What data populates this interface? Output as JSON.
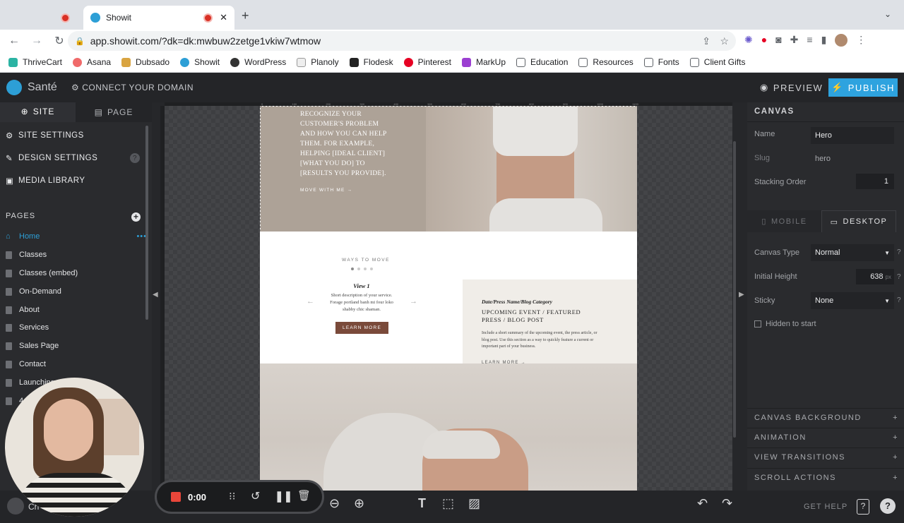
{
  "browser": {
    "tabs": [
      {
        "title": ""
      },
      {
        "title": "Showit"
      }
    ],
    "url": "app.showit.com/?dk=dk:mwbuw2zetge1vkiw7wtmow",
    "bookmarks": [
      "ThriveCart",
      "Asana",
      "Dubsado",
      "Showit",
      "WordPress",
      "Planoly",
      "Flodesk",
      "Pinterest",
      "MarkUp",
      "Education",
      "Resources",
      "Fonts",
      "Client Gifts"
    ]
  },
  "app": {
    "site_name": "Santé",
    "connect_domain": "CONNECT YOUR DOMAIN",
    "preview": "PREVIEW",
    "publish": "PUBLISH"
  },
  "left": {
    "tab_site": "SITE",
    "tab_page": "PAGE",
    "settings": [
      "SITE SETTINGS",
      "DESIGN SETTINGS",
      "MEDIA LIBRARY"
    ],
    "pages_heading": "PAGES",
    "pages": [
      "Home",
      "Classes",
      "Classes (embed)",
      "On-Demand",
      "About",
      "Services",
      "Sales Page",
      "Contact",
      "Launching"
    ],
    "partial_pages": [
      "4",
      "Ch"
    ]
  },
  "canvas": {
    "hero_text": "RECOGNIZE YOUR CUSTOMER'S PROBLEM AND HOW YOU CAN HELP THEM. FOR EXAMPLE, HELPING [IDEAL CLIENT] [WHAT YOU DO] TO [RESULTS YOU PROVIDE].",
    "move_link": "MOVE WITH ME →",
    "ways_heading": "WAYS TO MOVE",
    "view_title": "View 1",
    "view_desc": "Short description of your service. Forage portland banh mi four loko shabby chic shaman.",
    "learn_btn": "LEARN MORE",
    "card_category": "Date/Press Name/Blog Category",
    "card_title": "UPCOMING EVENT / FEATURED PRESS / BLOG POST",
    "card_summary": "Include a short summary of the upcoming event, the press article, or blog post. Use this section as a way to quickly feature a current or important part of your business.",
    "card_link": "LEARN MORE →",
    "ruler_ticks": [
      "0",
      "100",
      "200",
      "300",
      "400",
      "500",
      "600",
      "700",
      "800",
      "900",
      "1000",
      "1100"
    ]
  },
  "right": {
    "heading": "CANVAS",
    "name_label": "Name",
    "name_value": "Hero",
    "slug_label": "Slug",
    "slug_value": "hero",
    "stacking_label": "Stacking Order",
    "stacking_value": "1",
    "tab_mobile": "MOBILE",
    "tab_desktop": "DESKTOP",
    "canvas_type_label": "Canvas Type",
    "canvas_type_value": "Normal",
    "initial_height_label": "Initial Height",
    "initial_height_value": "638",
    "initial_height_unit": "px",
    "sticky_label": "Sticky",
    "sticky_value": "None",
    "hidden_label": "Hidden to start",
    "sections": [
      "CANVAS BACKGROUND",
      "ANIMATION",
      "VIEW TRANSITIONS",
      "SCROLL ACTIONS"
    ]
  },
  "bottom": {
    "recording_time": "0:00",
    "get_help": "GET HELP"
  },
  "colors": {
    "accent": "#2d9fd6",
    "publish": "#2ea3df",
    "brown_button": "#7a4a3a",
    "hero_bg": "#ada297"
  }
}
